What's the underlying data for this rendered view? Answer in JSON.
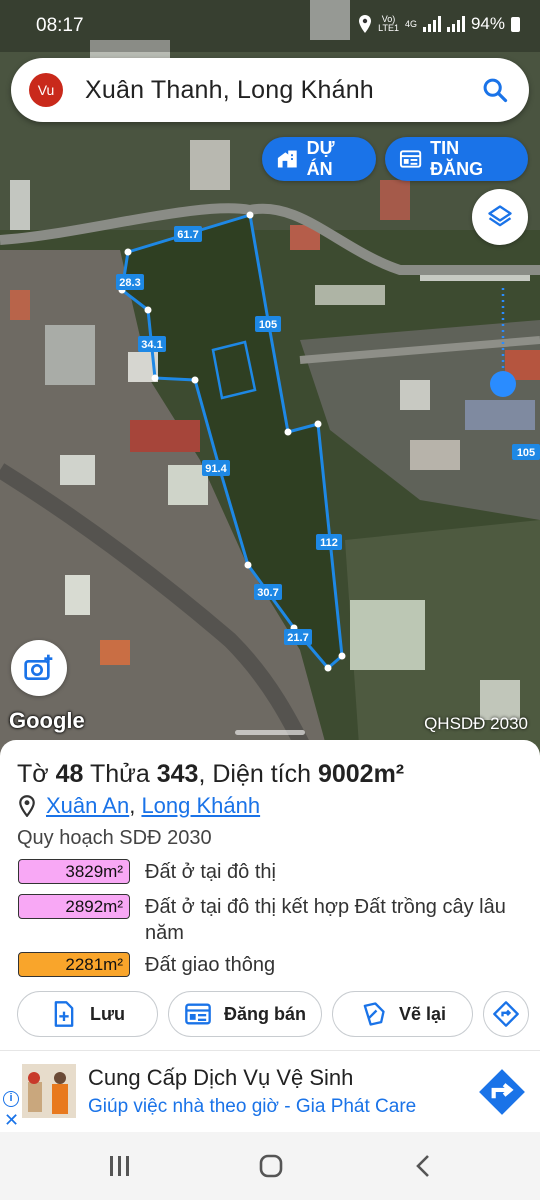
{
  "status_bar": {
    "time": "08:17",
    "network_top": "Vo)",
    "network_bottom": "LTE1",
    "net_type": "4G",
    "battery": "94%"
  },
  "search": {
    "avatar_text": "Vu",
    "title": "Xuân Thanh, Long Khánh"
  },
  "buttons": {
    "du_an": "DỰ ÁN",
    "tin_dang": "TIN ĐĂNG"
  },
  "map": {
    "edge_labels": [
      "61.7",
      "105",
      "28.3",
      "34.1",
      "91.4",
      "112",
      "30.7",
      "21.7"
    ],
    "side_label": "105",
    "brand": "Google",
    "layer_label": "QHSDĐ 2030",
    "boundary_color": "#1e88e5"
  },
  "parcel": {
    "sheet_label": "Tờ",
    "sheet_no": "48",
    "lot_label": "Thửa",
    "lot_no": "343",
    "area_label": ", Diện tích",
    "area": "9002m²",
    "ward": "Xuân An",
    "separator": ",",
    "city": "Long Khánh",
    "plan_title": "Quy hoạch SDĐ 2030",
    "zones": [
      {
        "area": "3829m²",
        "name": "Đất ở tại đô thị",
        "color": "#f8a8f5"
      },
      {
        "area": "2892m²",
        "name": "Đất ở tại đô thị kết hợp Đất trồng cây lâu năm",
        "color": "#f8a8f5"
      },
      {
        "area": "2281m²",
        "name": "Đất giao thông",
        "color": "#f9a52b"
      }
    ]
  },
  "actions": {
    "save": "Lưu",
    "post_sale": "Đăng bán",
    "redraw": "Vẽ lại"
  },
  "ad": {
    "title": "Cung Cấp Dịch Vụ Vệ Sinh",
    "subtitle": "Giúp việc nhà theo giờ - Gia Phát Care",
    "close": "✕",
    "info": "i"
  }
}
